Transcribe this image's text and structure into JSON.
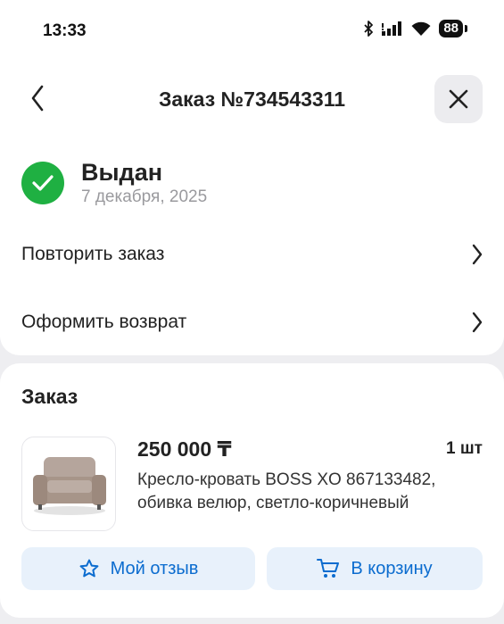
{
  "status_bar": {
    "time": "13:33",
    "battery": "88",
    "icons": [
      "bluetooth-icon",
      "signal-icon",
      "wifi-icon",
      "battery-icon"
    ]
  },
  "header": {
    "title": "Заказ №734543311",
    "back_icon": "chevron-left-icon",
    "close_icon": "close-icon"
  },
  "order_status": {
    "label": "Выдан",
    "date": "7 декабря, 2025",
    "icon": "check-circle-icon",
    "color": "#1fb042"
  },
  "actions": [
    {
      "label": "Повторить заказ",
      "icon": "chevron-right-icon"
    },
    {
      "label": "Оформить возврат",
      "icon": "chevron-right-icon"
    }
  ],
  "order": {
    "section_title": "Заказ",
    "item": {
      "price": "250 000 ₸",
      "quantity": "1 шт",
      "name_line1": "Кресло-кровать BOSS XO 867133482,",
      "name_line2": "обивка велюр, светло-коричневый",
      "image": "armchair-image"
    },
    "buttons": [
      {
        "label": "Мой отзыв",
        "icon": "star-icon"
      },
      {
        "label": "В корзину",
        "icon": "cart-icon"
      }
    ]
  },
  "colors": {
    "accent": "#0b6ccf",
    "button_bg": "#e8f1fb",
    "success": "#1fb042",
    "page_bg": "#eeeef1"
  }
}
